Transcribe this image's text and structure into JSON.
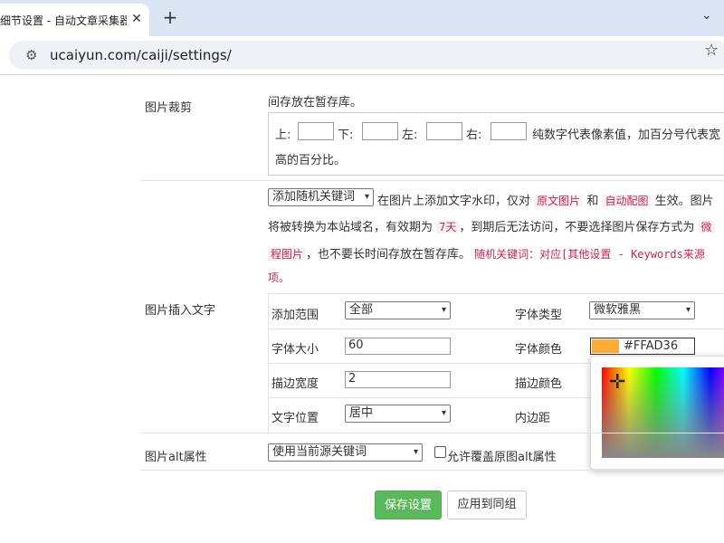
{
  "browser": {
    "tab_title": "细节设置 - 自动文章采集器",
    "tab_close": "✕",
    "new_tab": "+",
    "tab_list": "⌄",
    "url": "ucaiyun.com/caiji/settings/",
    "site_icon": "⚙",
    "star_icon": "☆",
    "back_icon": "←"
  },
  "crop": {
    "label": "图片裁剪",
    "desc_tail": "间存放在暂存库。",
    "top_label": "上:",
    "bottom_label": "下:",
    "left_label": "左:",
    "right_label": "右:",
    "top_value": "",
    "bottom_value": "",
    "left_value": "",
    "right_value": "",
    "hint_1": "纯数字代表像素值，加百分号代表宽",
    "hint_2": "高的百分比。"
  },
  "watermark": {
    "label": "图片插入文字",
    "mode_select": "添加随机关键词",
    "desc": {
      "p1": "在图片上添加文字水印，仅对",
      "orig_img": "原文图片",
      "and": "和",
      "auto_img": "自动配图",
      "p2": "生效。图片",
      "line2a": "将被转换为本站域名，有效期为",
      "days": "7天",
      "line2b": "，到期后无法访问，不要选择图片保存方式为",
      "line2c": "微",
      "line3a": "程图片",
      "line3b": "，也不要长时间存放在暂存库。",
      "line3c": "随机关键词：对应[其他设置 - Keywords来源",
      "line4": "项。"
    },
    "range_label": "添加范围",
    "range_value": "全部",
    "font_type_label": "字体类型",
    "font_type_value": "微软雅黑",
    "font_size_label": "字体大小",
    "font_size_value": "60",
    "font_color_label": "字体颜色",
    "font_color_value": "#FFAD36",
    "stroke_width_label": "描边宽度",
    "stroke_width_value": "2",
    "stroke_color_label": "描边颜色",
    "position_label": "文字位置",
    "position_value": "居中",
    "padding_label": "内边距"
  },
  "alt": {
    "label": "图片alt属性",
    "select_value": "使用当前源关键词",
    "checkbox_label": "允许覆盖原图alt属性"
  },
  "buttons": {
    "save": "保存设置",
    "apply_group": "应用到同组"
  },
  "colors": {
    "accent_green": "#5cb85c",
    "font_color": "#FFAD36",
    "code_red": "#c7254e"
  }
}
